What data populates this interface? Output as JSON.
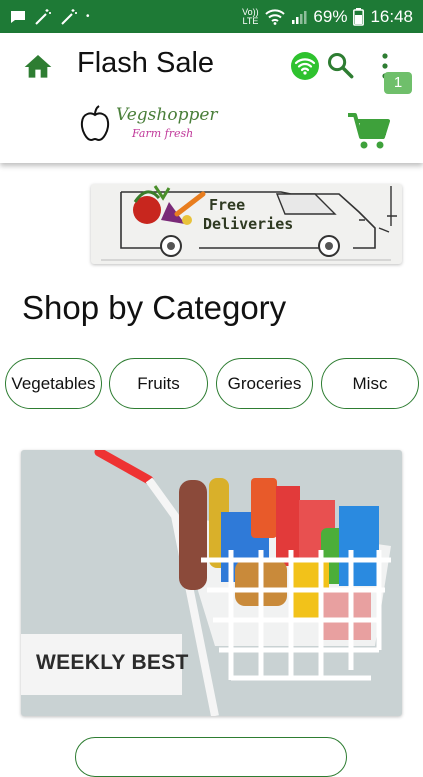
{
  "status_bar": {
    "battery": "69%",
    "time": "16:48",
    "volte": "Vo)) LTE"
  },
  "app_bar": {
    "title": "Flash Sale",
    "cart_count": "1",
    "logo": {
      "brand": "Vegshopper",
      "tagline": "Farm fresh"
    }
  },
  "banner": {
    "line1": "Free",
    "line2": "Deliveries"
  },
  "section": {
    "title": "Shop by Category"
  },
  "categories": [
    {
      "label": "Vegetables"
    },
    {
      "label": "Fruits"
    },
    {
      "label": "Groceries"
    },
    {
      "label": "Misc"
    }
  ],
  "promo": {
    "label": "WEEKLY BEST"
  },
  "colors": {
    "primary": "#2e7d32",
    "status_bar": "#1e7a36",
    "badge": "#6fbf6b"
  }
}
